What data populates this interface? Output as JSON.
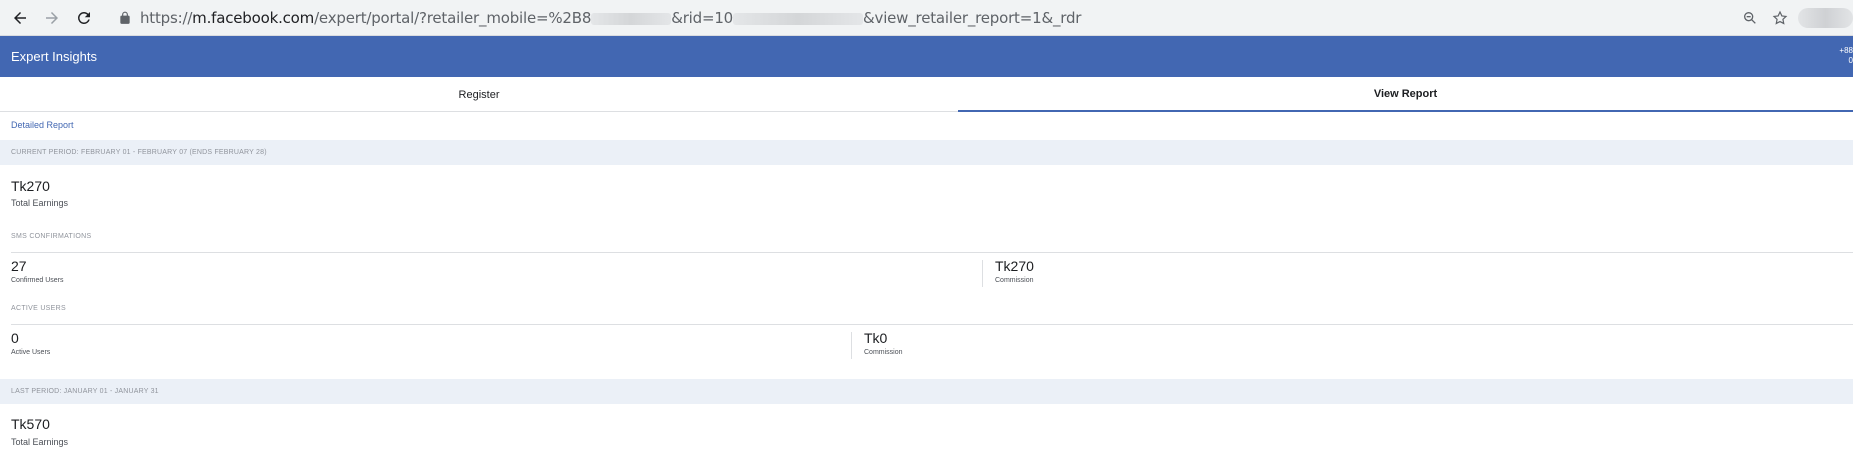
{
  "browser": {
    "url_scheme": "https://",
    "url_host": "m.facebook.com",
    "url_path_1": "/expert/portal/?retailer_mobile=%2B8",
    "url_path_2": "&rid=10",
    "url_path_3": "&view_retailer_report=1&_rdr"
  },
  "header": {
    "title": "Expert Insights",
    "right_text": "+88\n0"
  },
  "tabs": [
    {
      "label": "Register"
    },
    {
      "label": "View Report"
    }
  ],
  "detailed_report_link": "Detailed Report",
  "current_period": {
    "band_label": "CURRENT PERIOD: FEBRUARY 01 - FEBRUARY 07 (ENDS FEBRUARY 28)",
    "total_earnings_value": "Tk270",
    "total_earnings_label": "Total Earnings",
    "sms": {
      "section_label": "SMS CONFIRMATIONS",
      "confirmed_value": "27",
      "confirmed_label": "Confirmed Users",
      "commission_value": "Tk270",
      "commission_label": "Commission"
    },
    "active": {
      "section_label": "ACTIVE USERS",
      "active_value": "0",
      "active_label": "Active Users",
      "commission_value": "Tk0",
      "commission_label": "Commission"
    }
  },
  "last_period": {
    "band_label": "LAST PERIOD: JANUARY 01 - JANUARY 31",
    "total_earnings_value": "Tk570",
    "total_earnings_label": "Total Earnings"
  },
  "colors": {
    "brand": "#4267b2",
    "band": "#ebf0f7"
  }
}
